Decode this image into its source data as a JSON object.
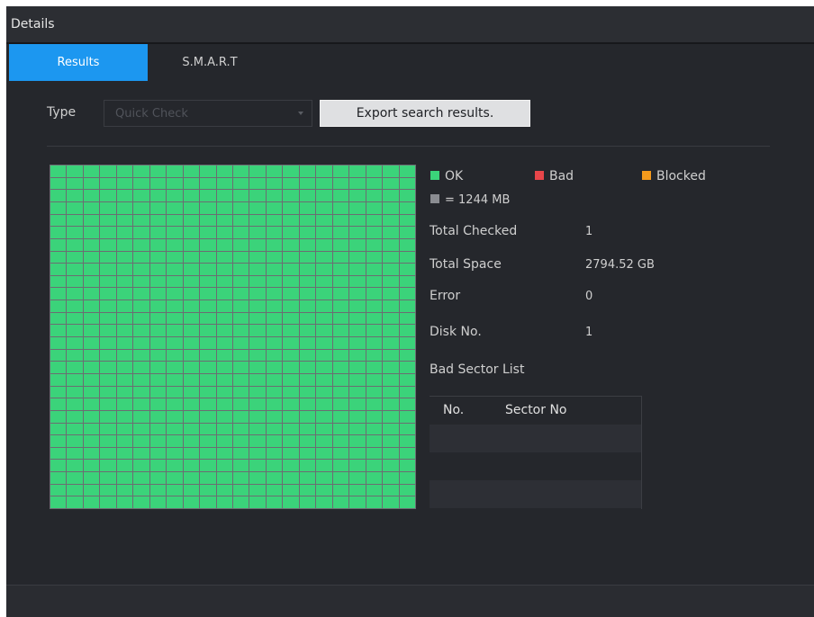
{
  "window": {
    "title": "Details"
  },
  "tabs": [
    {
      "label": "Results",
      "active": true
    },
    {
      "label": "S.M.A.R.T",
      "active": false
    }
  ],
  "filter": {
    "type_label": "Type",
    "type_value": "Quick Check",
    "export_label": "Export search results."
  },
  "grid": {
    "columns": 22,
    "rows": 28,
    "ok_color": "#3bd37a",
    "line_color": "#6b6d72"
  },
  "legend": {
    "ok": {
      "label": "OK",
      "color": "#3bd37a"
    },
    "bad": {
      "label": "Bad",
      "color": "#e8464a"
    },
    "blocked": {
      "label": "Blocked",
      "color": "#f59a1c"
    },
    "unit": {
      "label": "= 1244 MB",
      "color": "#8a8c91"
    }
  },
  "info": {
    "total_checked_label": "Total Checked",
    "total_checked_value": "1",
    "total_space_label": "Total Space",
    "total_space_value": "2794.52 GB",
    "error_label": "Error",
    "error_value": "0",
    "disk_no_label": "Disk No.",
    "disk_no_value": "1",
    "bad_sector_list_label": "Bad Sector List"
  },
  "bad_sector_table": {
    "col_no": "No.",
    "col_sector": "Sector No",
    "rows": []
  }
}
